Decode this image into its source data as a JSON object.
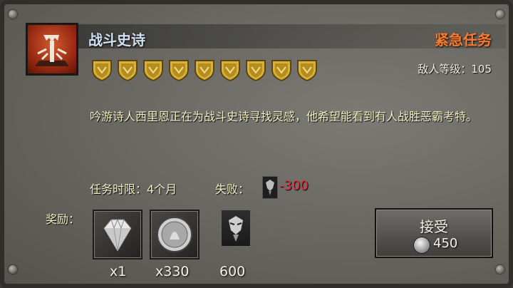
{
  "quest": {
    "title": "战斗史诗",
    "type": "紧急任务",
    "enemy_level": "敌人等级：105",
    "difficulty_shields": 9,
    "description": "吟游诗人西里恩正在为战斗史诗寻找灵感，他希望能看到有人战胜恶霸考特。",
    "time_limit": "任务时限：4个月",
    "fail_label": "失败：",
    "fail_value": "-300"
  },
  "rewards": {
    "label": "奖励：",
    "items": [
      {
        "icon": "diamond-icon",
        "quantity": "x1"
      },
      {
        "icon": "silver-coin-icon",
        "quantity": "x330"
      },
      {
        "icon": "stress-icon",
        "quantity": "600"
      }
    ]
  },
  "accept": {
    "label": "接受",
    "cost": "450",
    "cost_icon": "silver-coin-icon"
  },
  "colors": {
    "title": "#d2e0f2",
    "quest_type": "#ff7a2a",
    "fail_value": "#e0303c",
    "body_text": "#f4efc4"
  }
}
